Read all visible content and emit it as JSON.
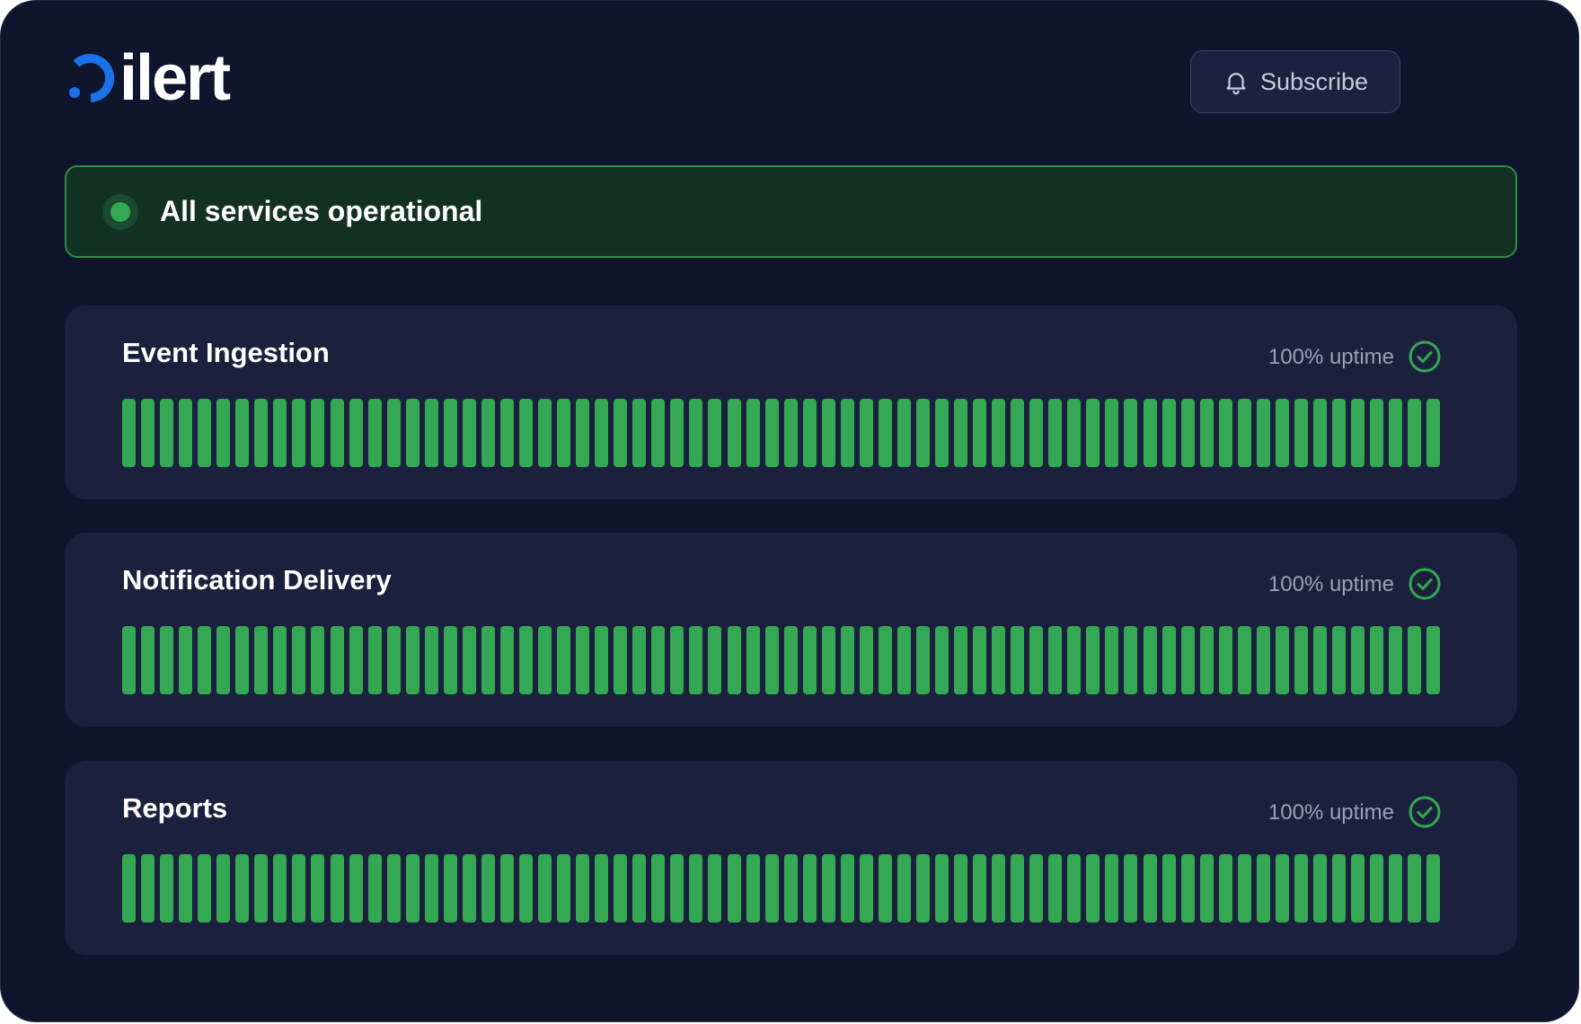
{
  "header": {
    "logo_text": "ilert",
    "brand_color": "#1a73e8",
    "subscribe_label": "Subscribe",
    "subscribe_icon": "bell-icon"
  },
  "banner": {
    "status": "operational",
    "text": "All services operational",
    "color": "#34a853"
  },
  "services": [
    {
      "name": "Event Ingestion",
      "uptime": "100% uptime",
      "days": 70,
      "days_operational": 70,
      "status_icon": "check-circle-icon"
    },
    {
      "name": "Notification Delivery",
      "uptime": "100% uptime",
      "days": 70,
      "days_operational": 70,
      "status_icon": "check-circle-icon"
    },
    {
      "name": "Reports",
      "uptime": "100% uptime",
      "days": 70,
      "days_operational": 70,
      "status_icon": "check-circle-icon"
    }
  ],
  "colors": {
    "background": "#10152e",
    "card": "#1b213d",
    "operational": "#34a853"
  }
}
